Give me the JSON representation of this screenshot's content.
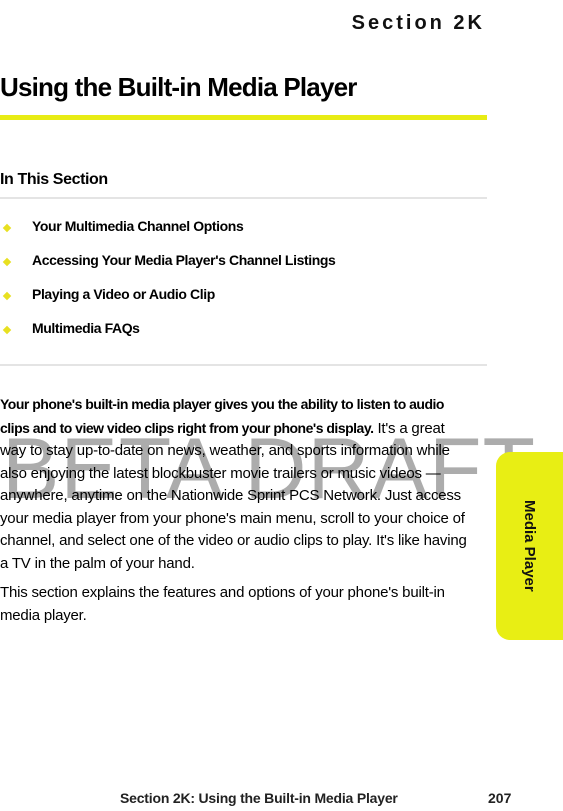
{
  "header": {
    "section": "Section 2K"
  },
  "title": "Using the Built-in Media Player",
  "in_this_section": {
    "label": "In This Section",
    "items": [
      "Your Multimedia Channel Options",
      "Accessing Your Media Player's Channel Listings",
      "Playing a Video or Audio Clip",
      "Multimedia FAQs"
    ]
  },
  "body": {
    "lead": "Your phone's built-in media player gives you the ability to listen to audio clips and to view video clips right from your phone's display.",
    "para1_rest": " It's a great way to stay up-to-date on news, weather, and sports information while also enjoying the latest blockbuster movie trailers or music videos — anywhere, anytime on the Nationwide Sprint PCS Network. Just access your media player from your phone's main menu, scroll to your choice of channel, and select one of the video or audio clips to play. It's like having a TV in the palm of your hand.",
    "para2": "This section explains the features and options of your phone's built-in media player."
  },
  "watermark": "BETA DRAFT",
  "side_tab": "Media Player",
  "footer": {
    "text": "Section 2K: Using the Built-in Media Player",
    "page": "207"
  },
  "colors": {
    "accent": "#e8ec14",
    "rule": "#e4e4e4"
  }
}
